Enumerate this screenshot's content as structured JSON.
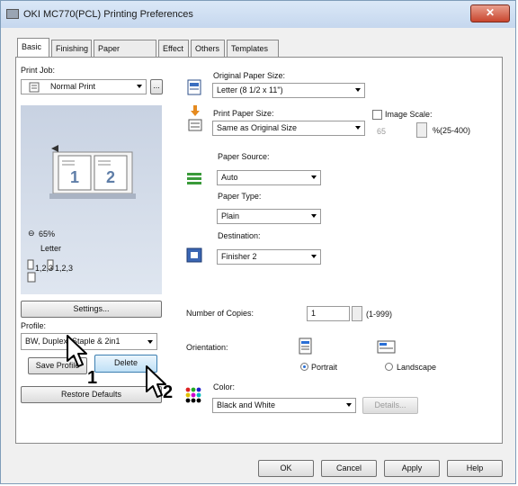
{
  "window": {
    "title": "OKI MC770(PCL) Printing Preferences",
    "close_symbol": "✕"
  },
  "tabs": [
    "Basic",
    "Finishing",
    "Paper Handling",
    "Effect",
    "Others",
    "Templates"
  ],
  "left": {
    "print_job_label": "Print Job:",
    "print_job_value": "Normal Print",
    "print_job_more": "...",
    "zoom_text": "65%",
    "paper_text": "Letter",
    "page_order_a": "1,2,3",
    "page_order_b": "1,2,3",
    "preview_page1": "1",
    "preview_page2": "2",
    "settings_label": "Settings...",
    "profile_label": "Profile:",
    "profile_value": "BW, Duplex, Staple & 2in1",
    "save_profile_label": "Save Profile",
    "delete_label": "Delete",
    "restore_defaults_label": "Restore Defaults"
  },
  "right": {
    "original_paper_size_label": "Original Paper Size:",
    "original_paper_size_value": "Letter (8 1/2 x 11\")",
    "print_paper_size_label": "Print Paper Size:",
    "print_paper_size_value": "Same as Original Size",
    "image_scale_label": "Image Scale:",
    "image_scale_value": "65",
    "image_scale_range": "%(25-400)",
    "paper_source_label": "Paper Source:",
    "paper_source_value": "Auto",
    "paper_type_label": "Paper Type:",
    "paper_type_value": "Plain",
    "destination_label": "Destination:",
    "destination_value": "Finisher 2",
    "copies_label": "Number of Copies:",
    "copies_value": "1",
    "copies_range": "(1-999)",
    "orientation_label": "Orientation:",
    "portrait_label": "Portrait",
    "landscape_label": "Landscape",
    "color_label": "Color:",
    "color_value": "Black and White",
    "details_label": "Details..."
  },
  "footer": {
    "ok_label": "OK",
    "cancel_label": "Cancel",
    "apply_label": "Apply",
    "help_label": "Help"
  },
  "callouts": {
    "step1": "1",
    "step2": "2"
  }
}
